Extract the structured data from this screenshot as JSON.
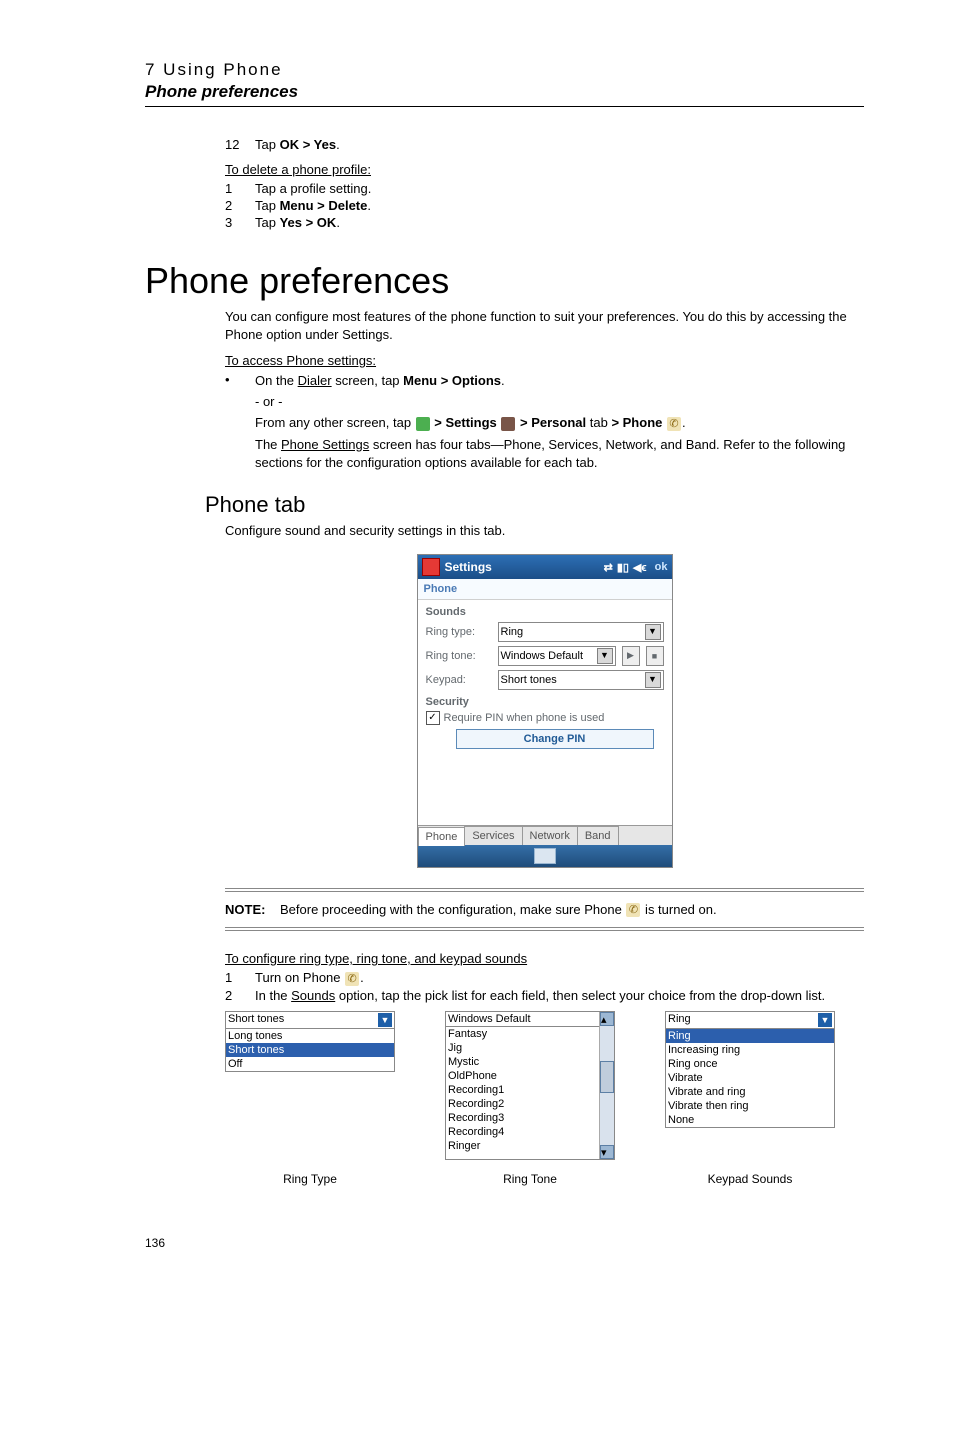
{
  "header": {
    "chapter": "7 Using Phone",
    "subtitle": "Phone preferences"
  },
  "steps_top": {
    "s12": {
      "num": "12",
      "prefix": "Tap ",
      "bold": "OK > Yes",
      "suffix": "."
    },
    "delete_heading": "To delete a phone profile:",
    "s1": {
      "num": "1",
      "text": "Tap a profile setting."
    },
    "s2": {
      "num": "2",
      "prefix": "Tap ",
      "bold": "Menu > Delete",
      "suffix": "."
    },
    "s3": {
      "num": "3",
      "prefix": "Tap ",
      "bold": "Yes > OK",
      "suffix": "."
    }
  },
  "main_heading": "Phone preferences",
  "intro": "You can configure most features of the phone function to suit your preferences. You do this by accessing the Phone option under Settings.",
  "access_heading": "To access Phone settings:",
  "access_bullet": {
    "pre1": "On the ",
    "link1": "Dialer",
    "post1": " screen, tap ",
    "bold1": "Menu > Options",
    "tail1": ".",
    "or": "- or -",
    "line2a": "From any other screen, tap ",
    "settings_bold": " > Settings ",
    "personal_bold": " > Personal",
    "tab_word": " tab ",
    "phone_bold": "> Phone ",
    "line3a": "The ",
    "link3": "Phone Settings",
    "line3b": " screen has four tabs—Phone, Services, Network, and Band. Refer to the following sections for the configuration options available for each tab."
  },
  "subheading": "Phone tab",
  "subdesc": "Configure sound and security settings in this tab.",
  "wm": {
    "title": "Settings",
    "ok": "ok",
    "header": "Phone",
    "sounds": "Sounds",
    "ring_type": "Ring type:",
    "ring_type_val": "Ring",
    "ring_tone": "Ring tone:",
    "ring_tone_val": "Windows Default",
    "keypad": "Keypad:",
    "keypad_val": "Short tones",
    "security": "Security",
    "require_pin": "Require PIN when phone is used",
    "change_pin": "Change PIN",
    "tabs": [
      "Phone",
      "Services",
      "Network",
      "Band"
    ]
  },
  "note": {
    "label": "NOTE:",
    "text_a": "Before proceeding with the configuration, make sure Phone ",
    "text_b": " is turned on."
  },
  "config_heading": "To configure ring type, ring tone, and keypad sounds",
  "config_steps": {
    "s1": {
      "num": "1",
      "prefix": "Turn on Phone ",
      "suffix": "."
    },
    "s2": {
      "num": "2",
      "prefix": "In the ",
      "link": "Sounds",
      "rest": " option, tap the pick list for each field, then select your choice from the drop-down list."
    }
  },
  "dd1": {
    "sel": "Short tones",
    "items": [
      "Long tones",
      "Short tones",
      "Off"
    ]
  },
  "dd2": {
    "sel": "Windows Default",
    "items": [
      "Fantasy",
      "Jig",
      "Mystic",
      "OldPhone",
      "Recording1",
      "Recording2",
      "Recording3",
      "Recording4",
      "Ringer"
    ]
  },
  "dd3": {
    "sel": "Ring",
    "items": [
      "Ring",
      "Increasing ring",
      "Ring once",
      "Vibrate",
      "Vibrate and ring",
      "Vibrate then ring",
      "None"
    ]
  },
  "captions": {
    "c1": "Ring Type",
    "c2": "Ring Tone",
    "c3": "Keypad Sounds"
  },
  "page_number": "136"
}
